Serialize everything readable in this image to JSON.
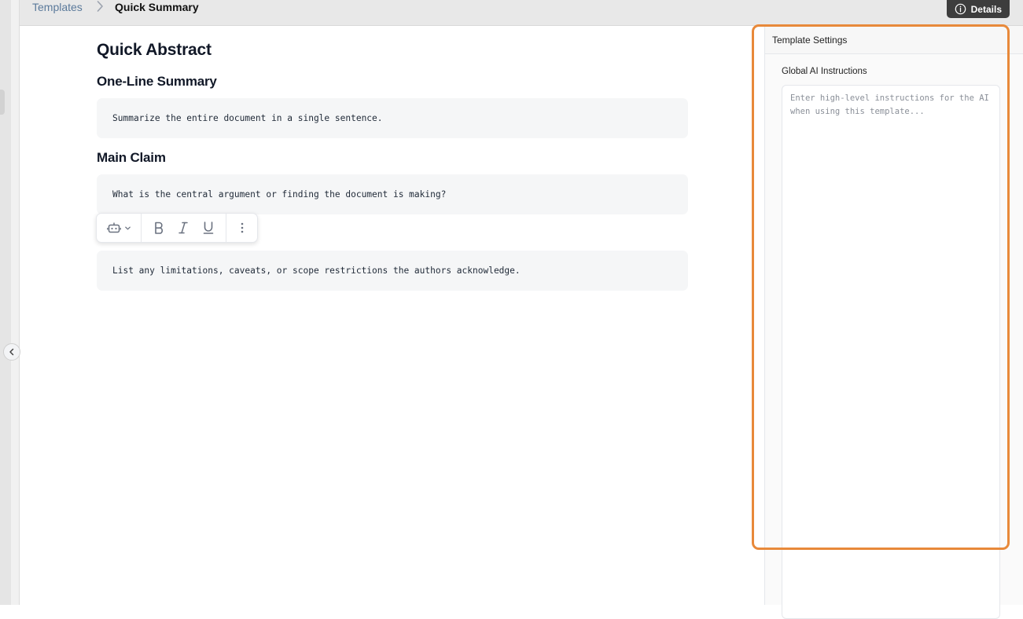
{
  "breadcrumb": {
    "parent": "Templates",
    "current": "Quick Summary"
  },
  "header": {
    "details_label": "Details",
    "details_icon": "info-icon"
  },
  "document": {
    "title": "Quick Abstract",
    "sections": [
      {
        "heading": "One-Line Summary",
        "prompt": "Summarize the entire document in a single sentence."
      },
      {
        "heading": "Main Claim",
        "prompt": "What is the central argument or finding the document is making?"
      },
      {
        "heading": "",
        "prompt": "List any limitations, caveats, or scope restrictions the authors acknowledge."
      }
    ]
  },
  "format_toolbar": {
    "icons": [
      "ai-bot-icon",
      "chevron-down-icon",
      "bold-icon",
      "italic-icon",
      "underline-icon",
      "more-vertical-icon"
    ]
  },
  "settings": {
    "panel_title": "Template Settings",
    "global_ai_label": "Global AI Instructions",
    "global_ai_value": "",
    "global_ai_placeholder": "Enter high-level instructions for the AI when using this template..."
  },
  "colors": {
    "highlight": "#e8893a",
    "details_bg": "#3d3d3d",
    "breadcrumb_link": "#5b7a9b",
    "prompt_bg": "#f5f6f7"
  }
}
